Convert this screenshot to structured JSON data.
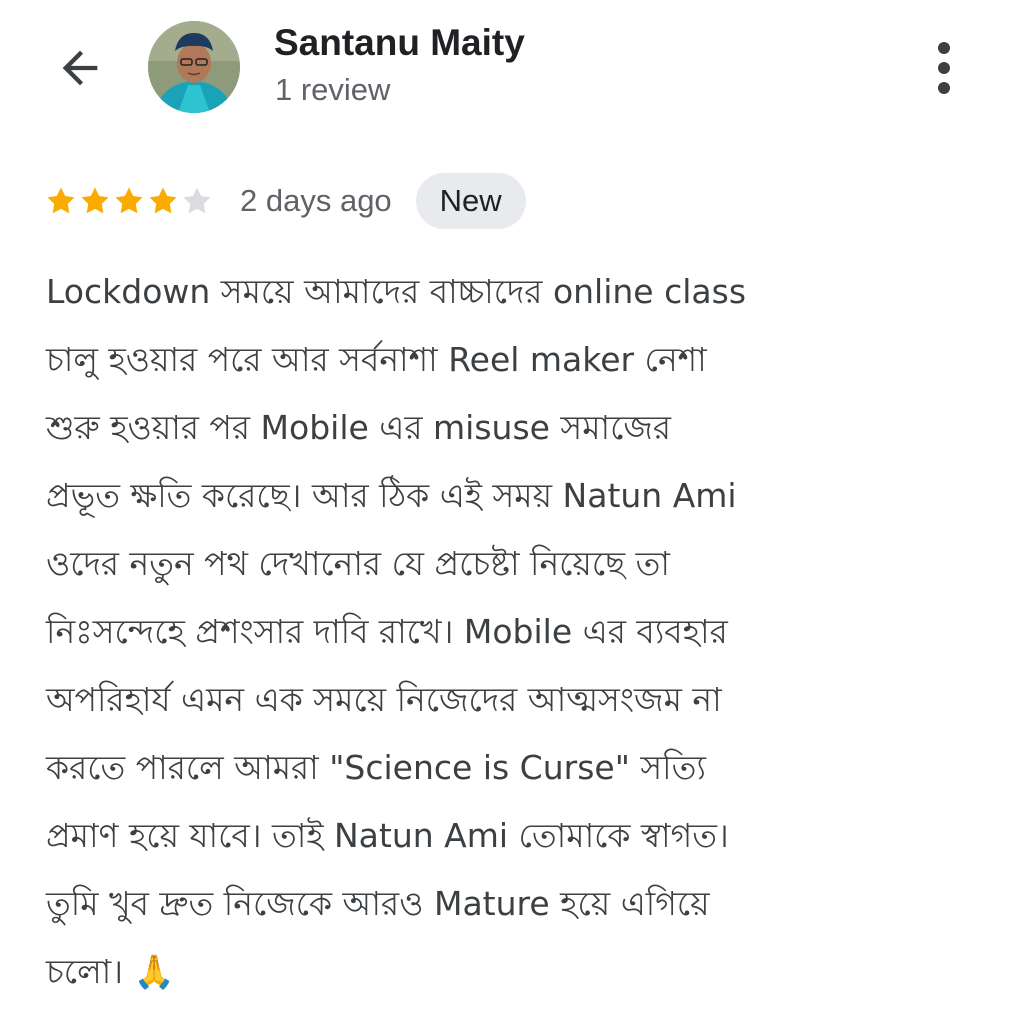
{
  "header": {
    "back_icon": "arrow-left-icon",
    "user_name": "Santanu Maity",
    "review_count": "1 review",
    "more_icon": "more-vert-icon"
  },
  "review": {
    "rating": 4,
    "max_rating": 5,
    "star_color": "#f9ab00",
    "empty_star_color": "#dadce0",
    "date": "2 days ago",
    "badge": "New",
    "lines": [
      "Lockdown সময়ে আমাদের বাচ্চাদের online class",
      "চালু হওয়ার পরে আর সর্বনাশা Reel maker নেশা",
      "শুরু হওয়ার পর Mobile এর misuse সমাজের",
      "প্রভূত ক্ষতি করেছে। আর ঠিক এই সময় Natun Ami",
      "ওদের নতুন পথ দেখানোর যে প্রচেষ্টা নিয়েছে তা",
      "নিঃসন্দেহে প্রশংসার দাবি রাখে। Mobile এর ব্যবহার",
      "অপরিহার্য এমন এক সময়ে নিজেদের আত্মসংজম না",
      "করতে পারলে আমরা \"Science is Curse\" সত্যি",
      "প্রমাণ হয়ে যাবে। তাই Natun Ami তোমাকে স্বাগত।",
      "তুমি খুব দ্রুত নিজেকে আরও Mature হয়ে এগিয়ে",
      "চলো। 🙏"
    ]
  }
}
